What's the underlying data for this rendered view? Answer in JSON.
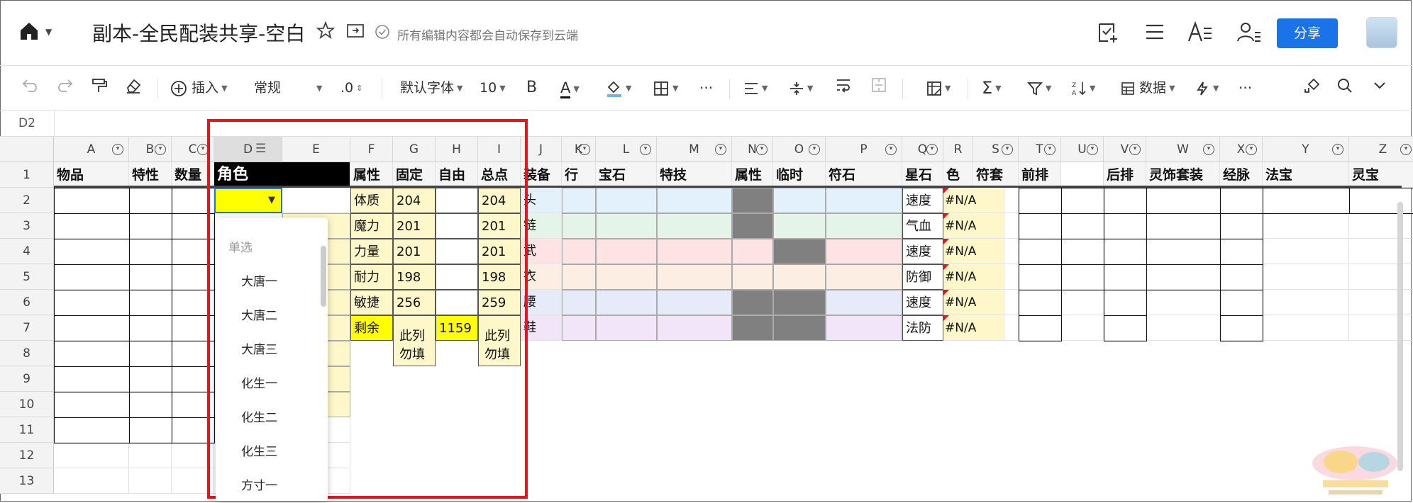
{
  "app": {
    "doc_title": "副本-全民配装共享-空白",
    "autosave_text": "所有编辑内容都会自动保存到云端",
    "share_label": "分享"
  },
  "toolbar": {
    "insert_label": "插入",
    "format_label": "常规",
    "decimal_label": ".0",
    "font_label": "默认字体",
    "size_label": "10",
    "bold_label": "B",
    "color_label": "A",
    "data_label": "数据",
    "more_label": "···"
  },
  "formula": {
    "cell_ref": "D2"
  },
  "columns": [
    "A",
    "B",
    "C",
    "D",
    "E",
    "F",
    "G",
    "H",
    "I",
    "J",
    "K",
    "L",
    "M",
    "N",
    "O",
    "P",
    "Q",
    "R",
    "S",
    "T",
    "U",
    "V",
    "W",
    "X",
    "Y",
    "Z"
  ],
  "rows": [
    "1",
    "2",
    "3",
    "4",
    "5",
    "6",
    "7",
    "8",
    "9",
    "10",
    "11",
    "12",
    "13"
  ],
  "header_row": {
    "A": "物品",
    "B": "特性",
    "C": "数量",
    "D": "角色",
    "F": "属性",
    "G": "固定",
    "H": "自由",
    "I": "总点",
    "J": "装备",
    "K": "行",
    "L": "宝石",
    "M": "特技",
    "N": "属性",
    "O": "临时",
    "P": "符石",
    "Q": "星石",
    "R": "色",
    "S": "符套",
    "T": "前排",
    "V": "后排",
    "W": "灵饰套装",
    "X": "经脉",
    "Y": "法宝",
    "Z": "灵宝"
  },
  "attributes": [
    {
      "name": "体质",
      "fixed": "204",
      "free": "",
      "total": "204",
      "equip": "头",
      "star": "速度",
      "color": "#N/A"
    },
    {
      "name": "魔力",
      "fixed": "201",
      "free": "",
      "total": "201",
      "equip": "链",
      "star": "气血",
      "color": "#N/A"
    },
    {
      "name": "力量",
      "fixed": "201",
      "free": "",
      "total": "201",
      "equip": "武",
      "star": "速度",
      "color": "#N/A"
    },
    {
      "name": "耐力",
      "fixed": "198",
      "free": "",
      "total": "198",
      "equip": "衣",
      "star": "防御",
      "color": "#N/A"
    },
    {
      "name": "敏捷",
      "fixed": "256",
      "free": "",
      "total": "259",
      "equip": "腰",
      "star": "速度",
      "color": "#N/A"
    },
    {
      "name": "剩余",
      "fixed": "",
      "free": "1159",
      "total": "",
      "equip": "鞋",
      "star": "法防",
      "color": "#N/A"
    }
  ],
  "notes": {
    "g_note": "此列勿填",
    "i_note": "此列勿填"
  },
  "dropdown": {
    "heading": "单选",
    "options": [
      "大唐一",
      "大唐二",
      "大唐三",
      "化生一",
      "化生二",
      "化生三",
      "方寸一"
    ]
  },
  "colors": {
    "share": "#1a73e8",
    "highlight_red": "#e8131b",
    "yellow": "#ffff00",
    "light_yellow": "#fdf7c9",
    "dark_header": "#000000",
    "gray_block": "#808080",
    "row_blue": "#e3f1fb",
    "row_green": "#e4f4e8",
    "row_pink": "#fde3e3",
    "row_peach": "#fdeee3",
    "row_lav": "#e7ebf9",
    "row_purple": "#f3e5f9"
  },
  "icons": [
    "home-icon",
    "star-icon",
    "move-folder-icon",
    "cloud-check-icon",
    "task-add-icon",
    "menu-icon",
    "font-size-icon",
    "user-settings-icon",
    "undo-icon",
    "redo-icon",
    "format-painter-icon",
    "eraser-icon",
    "insert-plus-icon",
    "border-icon",
    "align-left-icon",
    "valign-icon",
    "wrap-icon",
    "merge-icon",
    "cond-format-icon",
    "sum-icon",
    "filter-icon",
    "sort-icon",
    "data-icon",
    "flash-icon",
    "brush-icon",
    "search-icon",
    "chevron-down-icon"
  ]
}
